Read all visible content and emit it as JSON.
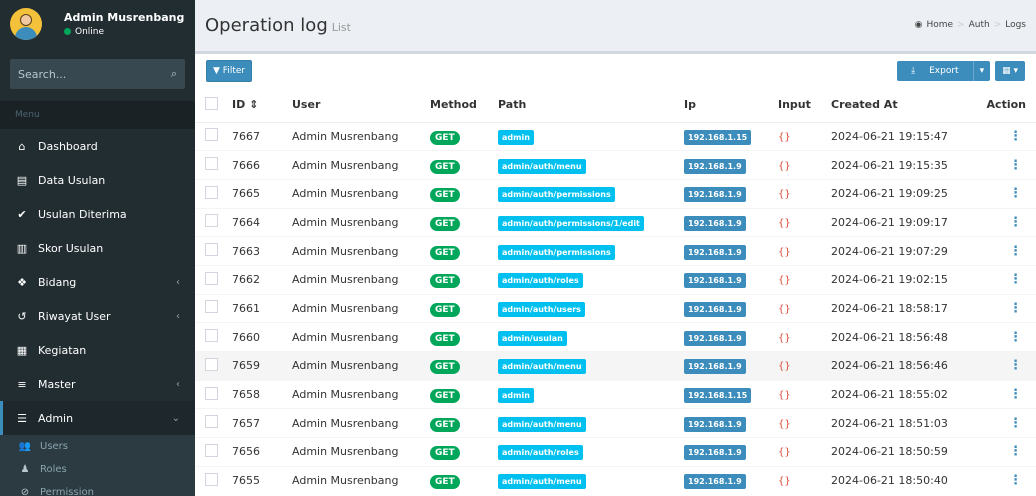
{
  "user": {
    "name": "Admin Musrenbang",
    "status": "Online"
  },
  "search": {
    "placeholder": "Search..."
  },
  "menu": {
    "header": "Menu",
    "items": [
      {
        "label": "Dashboard",
        "icon": "home-icon",
        "glyph": "⌂",
        "chev": ""
      },
      {
        "label": "Data Usulan",
        "icon": "file-icon",
        "glyph": "▤",
        "chev": ""
      },
      {
        "label": "Usulan Diterima",
        "icon": "check-icon",
        "glyph": "✔",
        "chev": ""
      },
      {
        "label": "Skor Usulan",
        "icon": "bar-chart-icon",
        "glyph": "▥",
        "chev": ""
      },
      {
        "label": "Bidang",
        "icon": "cubes-icon",
        "glyph": "❖",
        "chev": "‹"
      },
      {
        "label": "Riwayat User",
        "icon": "history-icon",
        "glyph": "↺",
        "chev": "‹"
      },
      {
        "label": "Kegiatan",
        "icon": "calendar-icon",
        "glyph": "▦",
        "chev": ""
      },
      {
        "label": "Master",
        "icon": "database-icon",
        "glyph": "≡",
        "chev": "‹"
      },
      {
        "label": "Admin",
        "icon": "tasks-icon",
        "glyph": "☰",
        "chev": "⌄"
      }
    ],
    "subitems": [
      {
        "label": "Users",
        "icon": "users-icon",
        "glyph": "👥"
      },
      {
        "label": "Roles",
        "icon": "user-icon",
        "glyph": "♟"
      },
      {
        "label": "Permission",
        "icon": "ban-icon",
        "glyph": "⊘"
      }
    ]
  },
  "header": {
    "title": "Operation log",
    "subtitle": "List"
  },
  "breadcrumb": {
    "home": "Home",
    "auth": "Auth",
    "logs": "Logs"
  },
  "toolbar": {
    "filter": "Filter",
    "export": "Export"
  },
  "table": {
    "headers": {
      "id": "ID",
      "user": "User",
      "method": "Method",
      "path": "Path",
      "ip": "Ip",
      "input": "Input",
      "created": "Created At",
      "action": "Action"
    },
    "rows": [
      {
        "id": "7667",
        "user": "Admin Musrenbang",
        "method": "GET",
        "path": "admin",
        "ip": "192.168.1.15",
        "input": "{}",
        "created": "2024-06-21 19:15:47"
      },
      {
        "id": "7666",
        "user": "Admin Musrenbang",
        "method": "GET",
        "path": "admin/auth/menu",
        "ip": "192.168.1.9",
        "input": "{}",
        "created": "2024-06-21 19:15:35"
      },
      {
        "id": "7665",
        "user": "Admin Musrenbang",
        "method": "GET",
        "path": "admin/auth/permissions",
        "ip": "192.168.1.9",
        "input": "{}",
        "created": "2024-06-21 19:09:25"
      },
      {
        "id": "7664",
        "user": "Admin Musrenbang",
        "method": "GET",
        "path": "admin/auth/permissions/1/edit",
        "ip": "192.168.1.9",
        "input": "{}",
        "created": "2024-06-21 19:09:17"
      },
      {
        "id": "7663",
        "user": "Admin Musrenbang",
        "method": "GET",
        "path": "admin/auth/permissions",
        "ip": "192.168.1.9",
        "input": "{}",
        "created": "2024-06-21 19:07:29"
      },
      {
        "id": "7662",
        "user": "Admin Musrenbang",
        "method": "GET",
        "path": "admin/auth/roles",
        "ip": "192.168.1.9",
        "input": "{}",
        "created": "2024-06-21 19:02:15"
      },
      {
        "id": "7661",
        "user": "Admin Musrenbang",
        "method": "GET",
        "path": "admin/auth/users",
        "ip": "192.168.1.9",
        "input": "{}",
        "created": "2024-06-21 18:58:17"
      },
      {
        "id": "7660",
        "user": "Admin Musrenbang",
        "method": "GET",
        "path": "admin/usulan",
        "ip": "192.168.1.9",
        "input": "{}",
        "created": "2024-06-21 18:56:48"
      },
      {
        "id": "7659",
        "user": "Admin Musrenbang",
        "method": "GET",
        "path": "admin/auth/menu",
        "ip": "192.168.1.9",
        "input": "{}",
        "created": "2024-06-21 18:56:46"
      },
      {
        "id": "7658",
        "user": "Admin Musrenbang",
        "method": "GET",
        "path": "admin",
        "ip": "192.168.1.15",
        "input": "{}",
        "created": "2024-06-21 18:55:02"
      },
      {
        "id": "7657",
        "user": "Admin Musrenbang",
        "method": "GET",
        "path": "admin/auth/menu",
        "ip": "192.168.1.9",
        "input": "{}",
        "created": "2024-06-21 18:51:03"
      },
      {
        "id": "7656",
        "user": "Admin Musrenbang",
        "method": "GET",
        "path": "admin/auth/roles",
        "ip": "192.168.1.9",
        "input": "{}",
        "created": "2024-06-21 18:50:59"
      },
      {
        "id": "7655",
        "user": "Admin Musrenbang",
        "method": "GET",
        "path": "admin/auth/menu",
        "ip": "192.168.1.9",
        "input": "{}",
        "created": "2024-06-21 18:50:40"
      }
    ]
  },
  "colors": {
    "sidebar": "#222d32",
    "accent": "#3c8dbc",
    "get_badge": "#00a65a",
    "path_badge": "#00c0ef",
    "input_text": "#dd4b39"
  }
}
